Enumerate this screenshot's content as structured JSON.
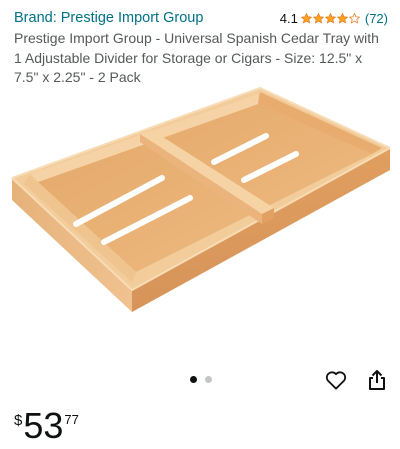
{
  "product": {
    "brand_label": "Brand: Prestige Import Group",
    "rating_value": "4.1",
    "rating_stars": 4.1,
    "review_count": "(72)",
    "title": "Prestige Import Group - Universal Spanish Cedar Tray with 1 Adjustable Divider for Storage or Cigars - Size: 12.5\" x 7.5\" x 2.25\" - 2 Pack",
    "image_alt": "cedar-tray-product-image"
  },
  "carousel": {
    "total_images": 2,
    "active_index": 0
  },
  "price": {
    "symbol": "$",
    "whole": "53",
    "fraction": "77"
  },
  "colors": {
    "link": "#007185",
    "star": "#ffa41c",
    "text": "#0f1111",
    "muted": "#565959"
  },
  "icons": {
    "wishlist": "heart-outline-icon",
    "share": "share-icon"
  }
}
